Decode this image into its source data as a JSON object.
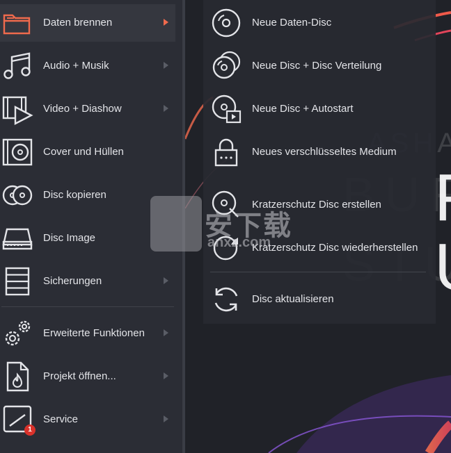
{
  "colors": {
    "accent": "#f06a4d",
    "sidebar_bg": "#2b2d35",
    "text": "#e3e4e8",
    "badge": "#d9322b"
  },
  "sidebar": {
    "items": [
      {
        "label": "Daten brennen",
        "icon": "folder-icon",
        "active": true,
        "has_arrow": true
      },
      {
        "label": "Audio + Musik",
        "icon": "music-note-icon",
        "has_arrow": true
      },
      {
        "label": "Video + Diashow",
        "icon": "film-play-icon",
        "has_arrow": true
      },
      {
        "label": "Cover und Hüllen",
        "icon": "cover-disc-icon",
        "has_arrow": false
      },
      {
        "label": "Disc kopieren",
        "icon": "copy-discs-icon",
        "has_arrow": false
      },
      {
        "label": "Disc Image",
        "icon": "drive-icon",
        "has_arrow": false
      },
      {
        "label": "Sicherungen",
        "icon": "backup-list-icon",
        "has_arrow": true
      },
      {
        "label": "Erweiterte Funktionen",
        "icon": "gears-icon",
        "has_arrow": true
      },
      {
        "label": "Projekt öffnen...",
        "icon": "project-file-icon",
        "has_arrow": true
      },
      {
        "label": "Service",
        "icon": "service-icon",
        "has_arrow": true,
        "badge": "1"
      }
    ]
  },
  "submenu": {
    "items": [
      {
        "label": "Neue Daten-Disc",
        "icon": "disc-icon"
      },
      {
        "label": "Neue Disc + Disc Verteilung",
        "icon": "multi-disc-icon"
      },
      {
        "label": "Neue Disc + Autostart",
        "icon": "disc-autostart-icon"
      },
      {
        "label": "Neues verschlüsseltes Medium",
        "icon": "lock-icon"
      },
      {
        "label": "Kratzerschutz Disc erstellen",
        "icon": "scratch-protect-icon"
      },
      {
        "label": "Kratzerschutz Disc wiederherstellen",
        "icon": "scratch-restore-icon"
      },
      {
        "label": "Disc aktualisieren",
        "icon": "refresh-icon"
      }
    ]
  },
  "brand": {
    "sub": "ASHAMP",
    "line1": "BUR",
    "line2": "STU",
    "big1": "F",
    "big2": "U"
  },
  "watermark": {
    "text": "安下载",
    "domain": "anxz.com"
  }
}
